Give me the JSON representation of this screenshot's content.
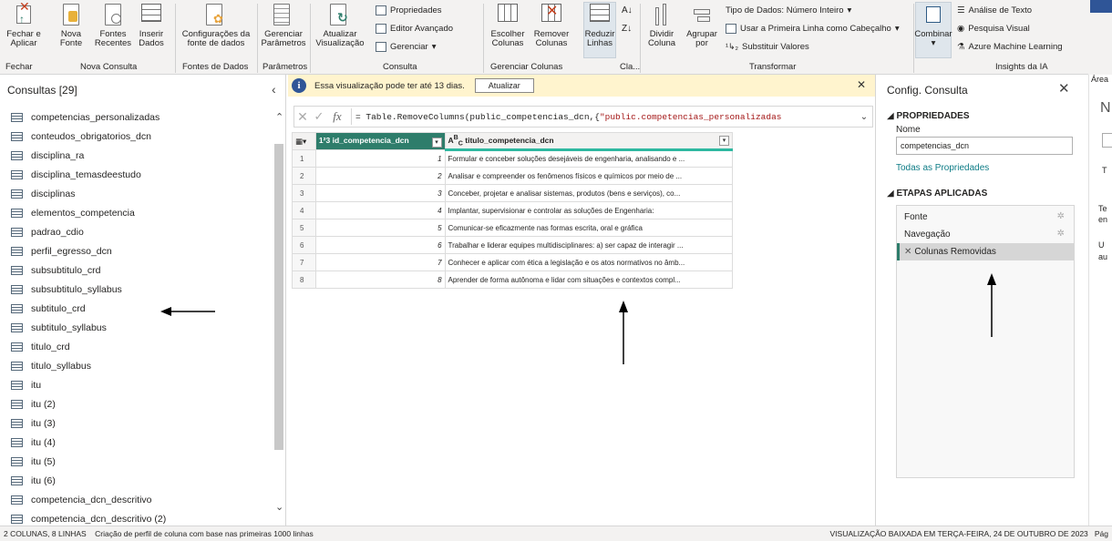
{
  "ribbon": {
    "groups": [
      {
        "label": "Fechar"
      },
      {
        "label": "Nova Consulta"
      },
      {
        "label": "Fontes de Dados"
      },
      {
        "label": "Parâmetros"
      },
      {
        "label": "Consulta"
      },
      {
        "label": "Gerenciar Colunas"
      },
      {
        "label": "Cla..."
      },
      {
        "label": "Transformar"
      },
      {
        "label": "Insights da IA"
      }
    ],
    "buttons": {
      "fechar_aplicar": "Fechar e Aplicar",
      "nova_fonte": "Nova Fonte",
      "fontes_recentes": "Fontes Recentes",
      "inserir_dados": "Inserir Dados",
      "config_fonte": "Configurações da fonte de dados",
      "gerenciar_parametros": "Gerenciar Parâmetros",
      "atualizar_visualizacao": "Atualizar Visualização",
      "propriedades": "Propriedades",
      "editor_avancado": "Editor Avançado",
      "gerenciar": "Gerenciar",
      "escolher_colunas": "Escolher Colunas",
      "remover_colunas": "Remover Colunas",
      "reduzir_linhas": "Reduzir Linhas",
      "dividir_coluna": "Dividir Coluna",
      "agrupar_por": "Agrupar por",
      "tipo_dados": "Tipo de Dados: Número Inteiro",
      "usar_primeira_linha": "Usar a Primeira Linha como Cabeçalho",
      "substituir_valores": "Substituir Valores",
      "combinar": "Combinar",
      "analise_texto": "Análise de Texto",
      "pesquisa_visual": "Pesquisa Visual",
      "azure_ml": "Azure Machine Learning"
    }
  },
  "queries_panel": {
    "title": "Consultas [29]",
    "items": [
      "competencias_personalizadas",
      "conteudos_obrigatorios_dcn",
      "disciplina_ra",
      "disciplina_temasdeestudo",
      "disciplinas",
      "elementos_competencia",
      "padrao_cdio",
      "perfil_egresso_dcn",
      "subsubtitulo_crd",
      "subsubtitulo_syllabus",
      "subtitulo_crd",
      "subtitulo_syllabus",
      "titulo_crd",
      "titulo_syllabus",
      "itu",
      "itu (2)",
      "itu (3)",
      "itu (4)",
      "itu (5)",
      "itu (6)",
      "competencia_dcn_descritivo",
      "competencia_dcn_descritivo (2)"
    ]
  },
  "banner": {
    "text": "Essa visualização pode ter até 13 dias.",
    "button": "Atualizar"
  },
  "formula": {
    "prefix": "= Table.RemoveColumns(public_competencias_dcn,{",
    "string": "\"public.competencias_personalizadas"
  },
  "grid": {
    "columns": [
      {
        "type_icon": "1²3",
        "name": "id_competencia_dcn"
      },
      {
        "type_icon": "A^B_C",
        "name": "titulo_competencia_dcn"
      }
    ],
    "rows": [
      {
        "n": "1",
        "id": "1",
        "titulo": "Formular e conceber soluções desejáveis de engenharia, analisando e ..."
      },
      {
        "n": "2",
        "id": "2",
        "titulo": "Analisar e compreender os fenômenos físicos e químicos por meio de ..."
      },
      {
        "n": "3",
        "id": "3",
        "titulo": "Conceber, projetar e analisar sistemas, produtos (bens e serviços), co..."
      },
      {
        "n": "4",
        "id": "4",
        "titulo": "Implantar, supervisionar e controlar as soluções de Engenharia:"
      },
      {
        "n": "5",
        "id": "5",
        "titulo": "Comunicar-se eficazmente nas formas escrita, oral e gráfica"
      },
      {
        "n": "6",
        "id": "6",
        "titulo": "Trabalhar e liderar equipes multidisciplinares: a) ser capaz de interagir ..."
      },
      {
        "n": "7",
        "id": "7",
        "titulo": "Conhecer e aplicar com ética a legislação e os atos normativos no âmb..."
      },
      {
        "n": "8",
        "id": "8",
        "titulo": "Aprender de forma autônoma e lidar com situações e contextos compl..."
      }
    ]
  },
  "settings_panel": {
    "title": "Config. Consulta",
    "properties_heading": "PROPRIEDADES",
    "name_label": "Nome",
    "name_value": "competencias_dcn",
    "all_properties": "Todas as Propriedades",
    "steps_heading": "ETAPAS APLICADAS",
    "steps": [
      "Fonte",
      "Navegação",
      "Colunas Removidas"
    ]
  },
  "right_edge": {
    "area": "Área",
    "n": "N",
    "t1": "T",
    "t2": "Te",
    "t3": "en",
    "u1": "U",
    "u2": "au"
  },
  "statusbar": {
    "left": "2 COLUNAS, 8 LINHAS    Criação de perfil de coluna com base nas primeiras 1000 linhas",
    "right": "VISUALIZAÇÃO BAIXADA EM TERÇA-FEIRA, 24 DE OUTUBRO DE 2023",
    "page": "Pág"
  },
  "colors": {
    "accent_green": "#2e7d6b",
    "banner_yellow": "#fff4ce",
    "ribbon_bg": "#f3f2f1"
  }
}
